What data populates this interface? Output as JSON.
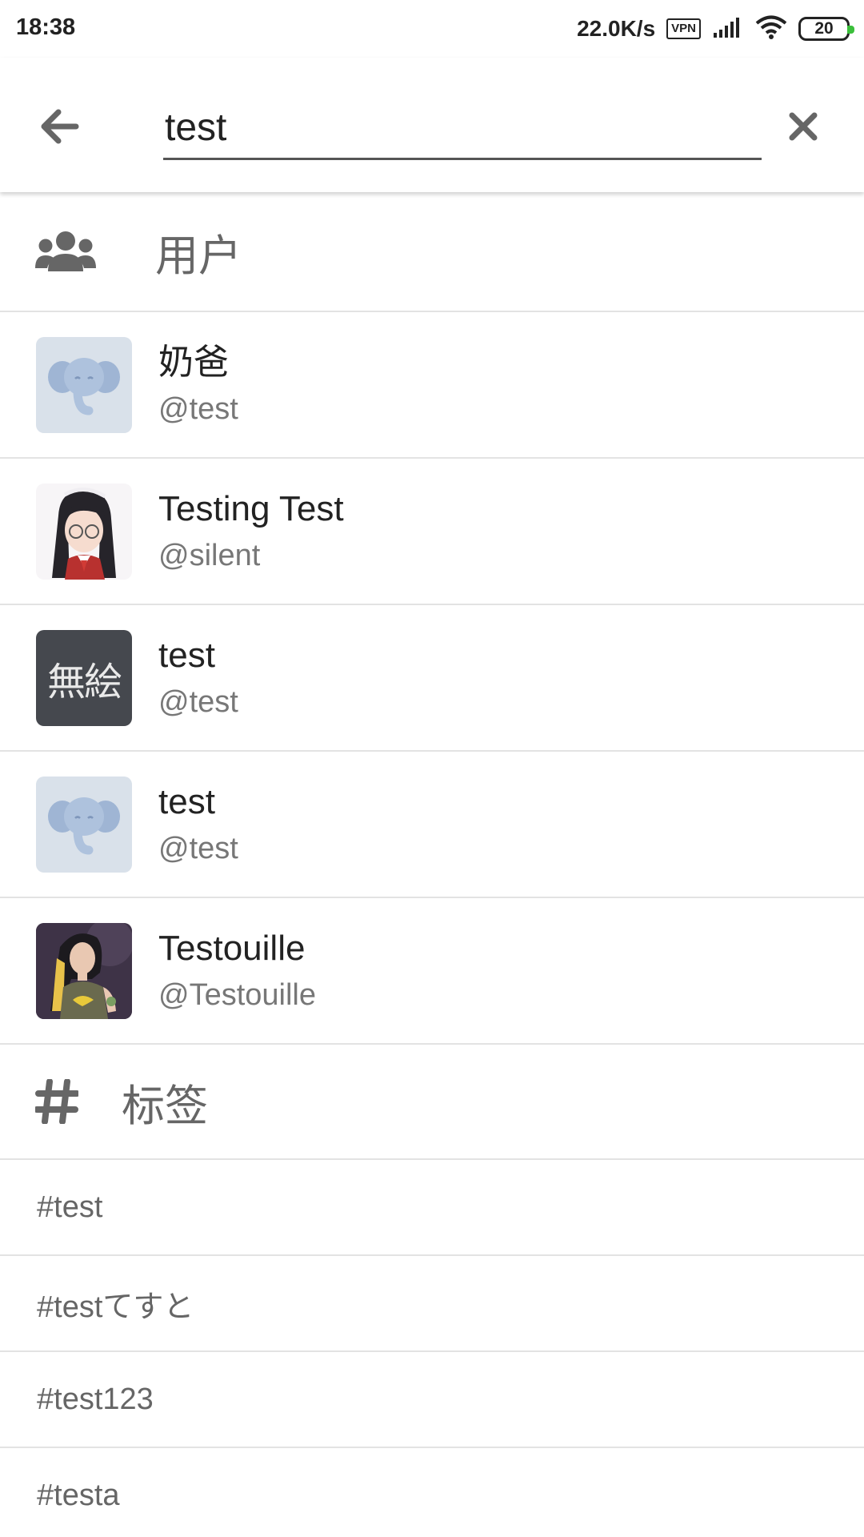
{
  "status_bar": {
    "time": "18:38",
    "net_speed": "22.0K/s",
    "vpn": "VPN",
    "battery": "20"
  },
  "search": {
    "query": "test",
    "back_icon": "arrow-left-icon",
    "clear_icon": "close-icon"
  },
  "users_section": {
    "title": "用户",
    "icon": "users-icon",
    "items": [
      {
        "display_name": "奶爸",
        "acct": "@test",
        "avatar": "default-elephant"
      },
      {
        "display_name": "Testing Test",
        "acct": "@silent",
        "avatar": "anime-girl-glasses"
      },
      {
        "display_name": "test",
        "acct": "@test",
        "avatar": "text-avatar",
        "avatar_text": "無絵"
      },
      {
        "display_name": "test",
        "acct": "@test",
        "avatar": "default-elephant"
      },
      {
        "display_name": "Testouille",
        "acct": "@Testouille",
        "avatar": "illustrated-woman"
      }
    ]
  },
  "tags_section": {
    "title": "标签",
    "icon": "hashtag-icon",
    "items": [
      "#test",
      "#testてすと",
      "#test123",
      "#testa"
    ]
  },
  "colors": {
    "accent_battery": "#3bbf3b",
    "divider": "#e3e3e3",
    "default_avatar_bg": "#d9e1ea",
    "default_avatar_fg": "#9fb5d4",
    "text_avatar_bg": "#45484e"
  }
}
